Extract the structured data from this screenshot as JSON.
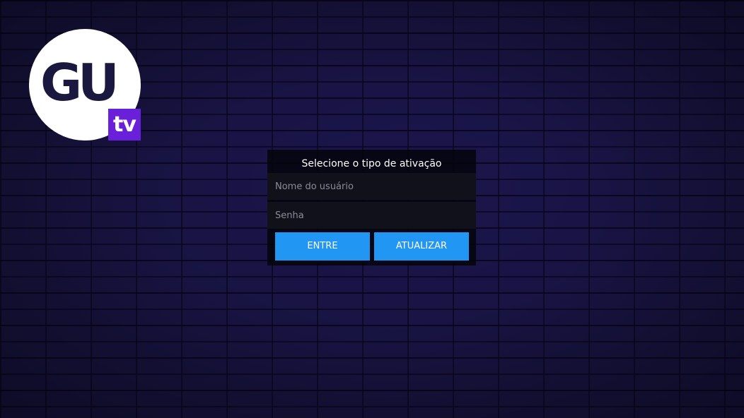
{
  "logo": {
    "main_text": "GU",
    "badge_text": "tv",
    "circle_color": "#ffffff",
    "text_color": "#1b1840",
    "badge_color": "#6a1fd8"
  },
  "activation": {
    "title": "Selecione o tipo de ativação",
    "username_placeholder": "Nome do usuário",
    "password_placeholder": "Senha",
    "enter_label": "ENTRE",
    "update_label": "ATUALIZAR",
    "button_color": "#2196f3"
  },
  "background": {
    "style": "dark blue brick wall",
    "color": "#16123c"
  }
}
